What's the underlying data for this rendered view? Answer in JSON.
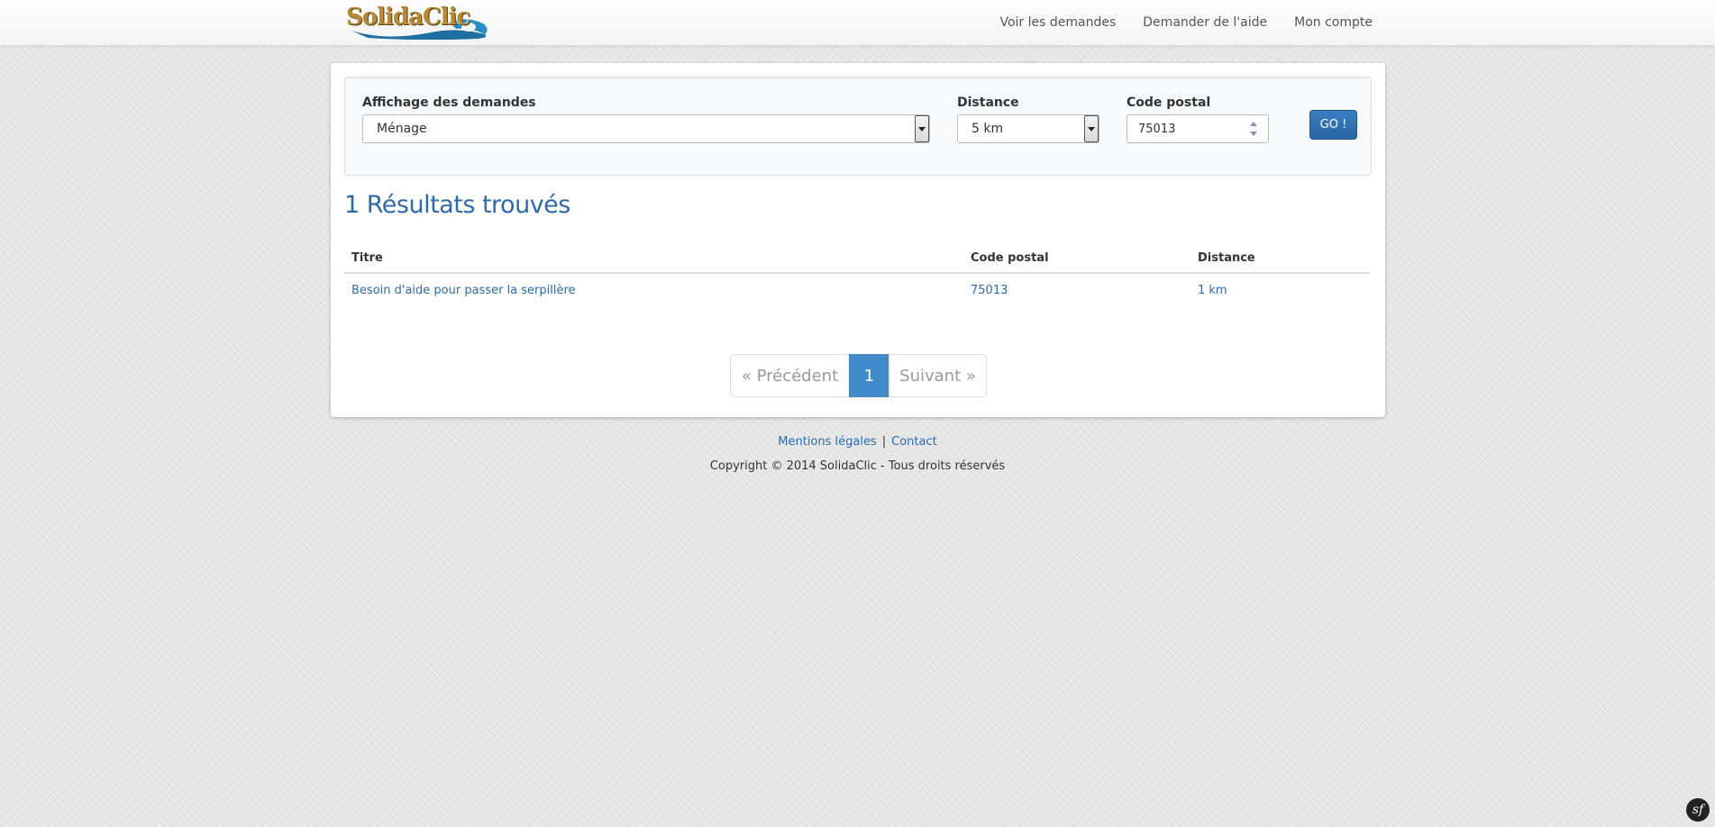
{
  "navbar": {
    "logo_text": "SolidaClic",
    "links": [
      {
        "label": "Voir les demandes"
      },
      {
        "label": "Demander de l'aide"
      },
      {
        "label": "Mon compte"
      }
    ]
  },
  "filters": {
    "category_label": "Affichage des demandes",
    "category_value": "Ménage",
    "distance_label": "Distance",
    "distance_value": "5 km",
    "postal_label": "Code postal",
    "postal_value": "75013",
    "go_label": "GO !"
  },
  "results": {
    "heading": "1 Résultats trouvés",
    "columns": [
      "Titre",
      "Code postal",
      "Distance"
    ],
    "rows": [
      {
        "title": "Besoin d'aide pour passer la serpillère",
        "postal": "75013",
        "distance": "1 km"
      }
    ]
  },
  "pagination": {
    "prev_label": "« Précédent",
    "current_page": "1",
    "next_label": "Suivant »"
  },
  "footer": {
    "legal_label": "Mentions légales",
    "separator": "|",
    "contact_label": "Contact",
    "copyright": "Copyright © 2014 SolidaClic - Tous droits réservés"
  },
  "badge": {
    "symbol": "sf"
  },
  "colors": {
    "accent": "#2b6aad",
    "button": "#2a65a5",
    "active_page": "#428bca"
  },
  "icons": {
    "select_arrow": "chevron-down-icon",
    "spinner": "spinner-arrows-icon",
    "symfony": "symfony-icon"
  }
}
